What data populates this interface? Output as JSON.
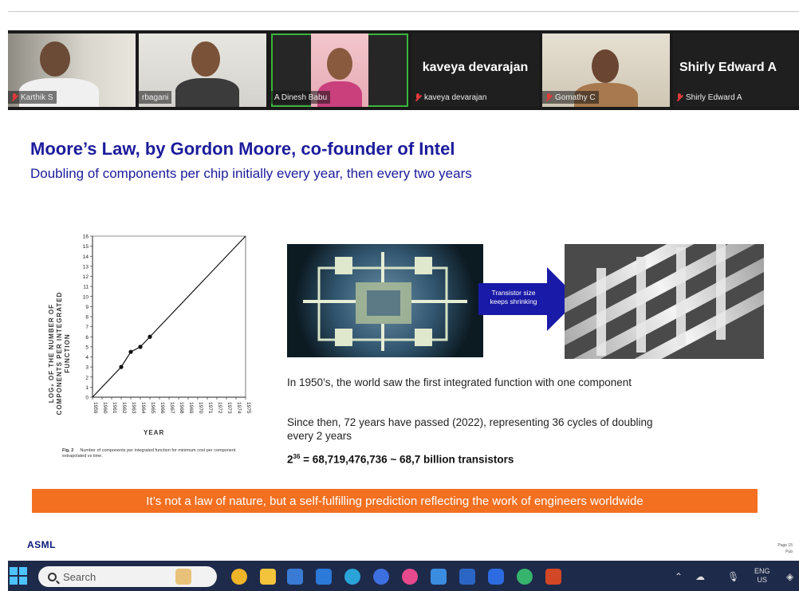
{
  "meeting": {
    "participants": [
      {
        "name": "Karthik S",
        "muted": true
      },
      {
        "name": "rbagani",
        "muted": false
      },
      {
        "name": "A Dinesh Babu",
        "muted": false,
        "active": true
      },
      {
        "name": "kaveya devarajan",
        "muted": true,
        "camera_off": true,
        "display_name": "kaveya devarajan"
      },
      {
        "name": "Gomathy C",
        "muted": true
      },
      {
        "name": "Shirly Edward A",
        "muted": true,
        "camera_off": true,
        "display_name": "Shirly Edward A"
      }
    ]
  },
  "slide": {
    "title": "Moore’s Law, by Gordon Moore, co-founder of Intel",
    "subtitle": "Doubling of components per chip initially every year, then every two years",
    "graph": {
      "ylabel": "LOG₂ OF THE NUMBER OF COMPONENTS PER INTEGRATED FUNCTION",
      "xlabel": "YEAR",
      "caption_fig": "Fig. 2",
      "caption_text": "Number of components per integrated function for minimum cost per component extrapolated vs time."
    },
    "arrow_text": "Transistor size keeps shrinking",
    "para1": "In 1950’s, the world saw the first integrated function with one component",
    "para2": "Since then, 72 years have passed (2022), representing 36 cycles of doubling every 2 years",
    "formula_base": "2",
    "formula_exp": "36",
    "formula_rest": " = 68,719,476,736 ~ 68,7 billion transistors",
    "banner": "It’s not a law of nature, but a self-fulfilling prediction reflecting the work of engineers worldwide",
    "logo": "ASML",
    "page_label": "Page 15",
    "page_label2": "Pub"
  },
  "taskbar": {
    "search_placeholder": "Search",
    "lang_top": "ENG",
    "lang_bottom": "US"
  },
  "chart_data": {
    "type": "line",
    "x": [
      1959,
      1962,
      1963,
      1964,
      1965,
      1975
    ],
    "y": [
      0,
      3,
      4.5,
      5,
      6,
      16
    ],
    "x_ticks": [
      "1959",
      "1960",
      "1961",
      "1962",
      "1963",
      "1964",
      "1965",
      "1966",
      "1967",
      "1968",
      "1969",
      "1970",
      "1971",
      "1972",
      "1973",
      "1974",
      "1975"
    ],
    "y_ticks": [
      "0",
      "1",
      "2",
      "3",
      "4",
      "5",
      "6",
      "7",
      "8",
      "9",
      "10",
      "11",
      "12",
      "13",
      "14",
      "15",
      "16"
    ],
    "xlim": [
      1959,
      1975
    ],
    "ylim": [
      0,
      16
    ],
    "points": [
      [
        1962,
        3
      ],
      [
        1963,
        4.5
      ],
      [
        1964,
        5
      ],
      [
        1965,
        6
      ]
    ],
    "grid": false
  }
}
